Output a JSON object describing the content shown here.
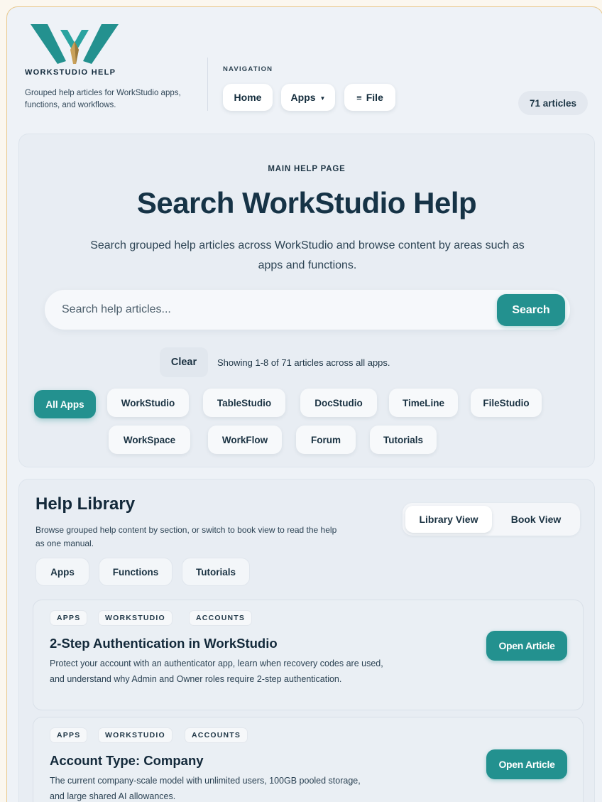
{
  "brand": {
    "name": "WORKSTUDIO HELP",
    "description": "Grouped help articles for WorkStudio apps, functions, and workflows.",
    "logo_icon": "workstudio-w-logo",
    "colors": {
      "teal": "#23918f",
      "gold": "#c9a15a",
      "navy": "#163346"
    }
  },
  "navigation": {
    "label": "NAVIGATION",
    "home": "Home",
    "apps": "Apps",
    "file": "File",
    "apps_icon": "caret-down-icon",
    "file_icon": "hamburger-icon"
  },
  "article_count_badge": "71 articles",
  "hero": {
    "eyebrow": "MAIN HELP PAGE",
    "title": "Search WorkStudio Help",
    "subtitle": "Search grouped help articles across WorkStudio and browse content by areas such as apps and functions.",
    "search_placeholder": "Search help articles...",
    "search_button": "Search",
    "clear_button": "Clear",
    "showing_text": "Showing 1-8 of 71 articles across all apps."
  },
  "app_filters": [
    "All Apps",
    "WorkStudio",
    "TableStudio",
    "DocStudio",
    "TimeLine",
    "FileStudio",
    "WorkSpace",
    "WorkFlow",
    "Forum",
    "Tutorials"
  ],
  "active_filter": "All Apps",
  "library": {
    "title": "Help Library",
    "description": "Browse grouped help content by section, or switch to book view to read the help as one manual.",
    "views": [
      "Library View",
      "Book View"
    ],
    "active_view": "Library View",
    "sections": [
      "Apps",
      "Functions",
      "Tutorials"
    ],
    "articles": [
      {
        "tags": [
          "APPS",
          "WORKSTUDIO",
          "ACCOUNTS"
        ],
        "title": "2-Step Authentication in WorkStudio",
        "description": "Protect your account with an authenticator app, learn when recovery codes are used, and understand why Admin and Owner roles require 2-step authentication.",
        "button": "Open Article"
      },
      {
        "tags": [
          "APPS",
          "WORKSTUDIO",
          "ACCOUNTS"
        ],
        "title": "Account Type: Company",
        "description": "The current company-scale model with unlimited users, 100GB pooled storage, and large shared AI allowances.",
        "button": "Open Article"
      }
    ]
  }
}
